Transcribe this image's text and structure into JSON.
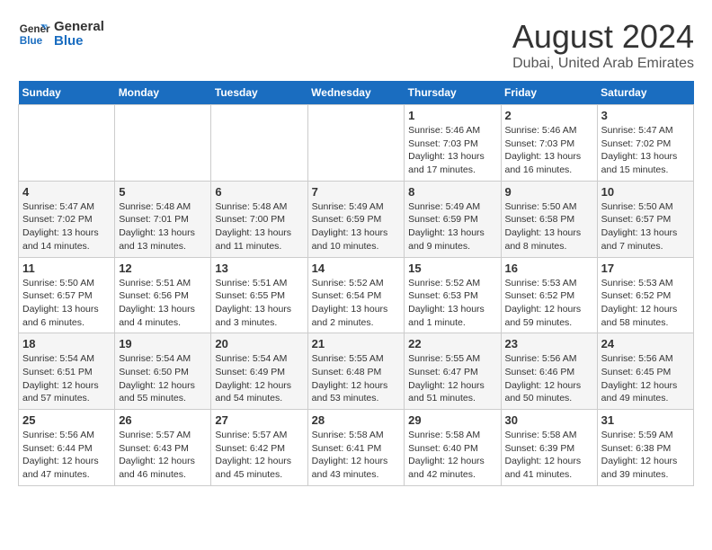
{
  "header": {
    "logo_line1": "General",
    "logo_line2": "Blue",
    "main_title": "August 2024",
    "sub_title": "Dubai, United Arab Emirates"
  },
  "days_of_week": [
    "Sunday",
    "Monday",
    "Tuesday",
    "Wednesday",
    "Thursday",
    "Friday",
    "Saturday"
  ],
  "weeks": [
    [
      {
        "num": "",
        "info": ""
      },
      {
        "num": "",
        "info": ""
      },
      {
        "num": "",
        "info": ""
      },
      {
        "num": "",
        "info": ""
      },
      {
        "num": "1",
        "info": "Sunrise: 5:46 AM\nSunset: 7:03 PM\nDaylight: 13 hours\nand 17 minutes."
      },
      {
        "num": "2",
        "info": "Sunrise: 5:46 AM\nSunset: 7:03 PM\nDaylight: 13 hours\nand 16 minutes."
      },
      {
        "num": "3",
        "info": "Sunrise: 5:47 AM\nSunset: 7:02 PM\nDaylight: 13 hours\nand 15 minutes."
      }
    ],
    [
      {
        "num": "4",
        "info": "Sunrise: 5:47 AM\nSunset: 7:02 PM\nDaylight: 13 hours\nand 14 minutes."
      },
      {
        "num": "5",
        "info": "Sunrise: 5:48 AM\nSunset: 7:01 PM\nDaylight: 13 hours\nand 13 minutes."
      },
      {
        "num": "6",
        "info": "Sunrise: 5:48 AM\nSunset: 7:00 PM\nDaylight: 13 hours\nand 11 minutes."
      },
      {
        "num": "7",
        "info": "Sunrise: 5:49 AM\nSunset: 6:59 PM\nDaylight: 13 hours\nand 10 minutes."
      },
      {
        "num": "8",
        "info": "Sunrise: 5:49 AM\nSunset: 6:59 PM\nDaylight: 13 hours\nand 9 minutes."
      },
      {
        "num": "9",
        "info": "Sunrise: 5:50 AM\nSunset: 6:58 PM\nDaylight: 13 hours\nand 8 minutes."
      },
      {
        "num": "10",
        "info": "Sunrise: 5:50 AM\nSunset: 6:57 PM\nDaylight: 13 hours\nand 7 minutes."
      }
    ],
    [
      {
        "num": "11",
        "info": "Sunrise: 5:50 AM\nSunset: 6:57 PM\nDaylight: 13 hours\nand 6 minutes."
      },
      {
        "num": "12",
        "info": "Sunrise: 5:51 AM\nSunset: 6:56 PM\nDaylight: 13 hours\nand 4 minutes."
      },
      {
        "num": "13",
        "info": "Sunrise: 5:51 AM\nSunset: 6:55 PM\nDaylight: 13 hours\nand 3 minutes."
      },
      {
        "num": "14",
        "info": "Sunrise: 5:52 AM\nSunset: 6:54 PM\nDaylight: 13 hours\nand 2 minutes."
      },
      {
        "num": "15",
        "info": "Sunrise: 5:52 AM\nSunset: 6:53 PM\nDaylight: 13 hours\nand 1 minute."
      },
      {
        "num": "16",
        "info": "Sunrise: 5:53 AM\nSunset: 6:52 PM\nDaylight: 12 hours\nand 59 minutes."
      },
      {
        "num": "17",
        "info": "Sunrise: 5:53 AM\nSunset: 6:52 PM\nDaylight: 12 hours\nand 58 minutes."
      }
    ],
    [
      {
        "num": "18",
        "info": "Sunrise: 5:54 AM\nSunset: 6:51 PM\nDaylight: 12 hours\nand 57 minutes."
      },
      {
        "num": "19",
        "info": "Sunrise: 5:54 AM\nSunset: 6:50 PM\nDaylight: 12 hours\nand 55 minutes."
      },
      {
        "num": "20",
        "info": "Sunrise: 5:54 AM\nSunset: 6:49 PM\nDaylight: 12 hours\nand 54 minutes."
      },
      {
        "num": "21",
        "info": "Sunrise: 5:55 AM\nSunset: 6:48 PM\nDaylight: 12 hours\nand 53 minutes."
      },
      {
        "num": "22",
        "info": "Sunrise: 5:55 AM\nSunset: 6:47 PM\nDaylight: 12 hours\nand 51 minutes."
      },
      {
        "num": "23",
        "info": "Sunrise: 5:56 AM\nSunset: 6:46 PM\nDaylight: 12 hours\nand 50 minutes."
      },
      {
        "num": "24",
        "info": "Sunrise: 5:56 AM\nSunset: 6:45 PM\nDaylight: 12 hours\nand 49 minutes."
      }
    ],
    [
      {
        "num": "25",
        "info": "Sunrise: 5:56 AM\nSunset: 6:44 PM\nDaylight: 12 hours\nand 47 minutes."
      },
      {
        "num": "26",
        "info": "Sunrise: 5:57 AM\nSunset: 6:43 PM\nDaylight: 12 hours\nand 46 minutes."
      },
      {
        "num": "27",
        "info": "Sunrise: 5:57 AM\nSunset: 6:42 PM\nDaylight: 12 hours\nand 45 minutes."
      },
      {
        "num": "28",
        "info": "Sunrise: 5:58 AM\nSunset: 6:41 PM\nDaylight: 12 hours\nand 43 minutes."
      },
      {
        "num": "29",
        "info": "Sunrise: 5:58 AM\nSunset: 6:40 PM\nDaylight: 12 hours\nand 42 minutes."
      },
      {
        "num": "30",
        "info": "Sunrise: 5:58 AM\nSunset: 6:39 PM\nDaylight: 12 hours\nand 41 minutes."
      },
      {
        "num": "31",
        "info": "Sunrise: 5:59 AM\nSunset: 6:38 PM\nDaylight: 12 hours\nand 39 minutes."
      }
    ]
  ]
}
